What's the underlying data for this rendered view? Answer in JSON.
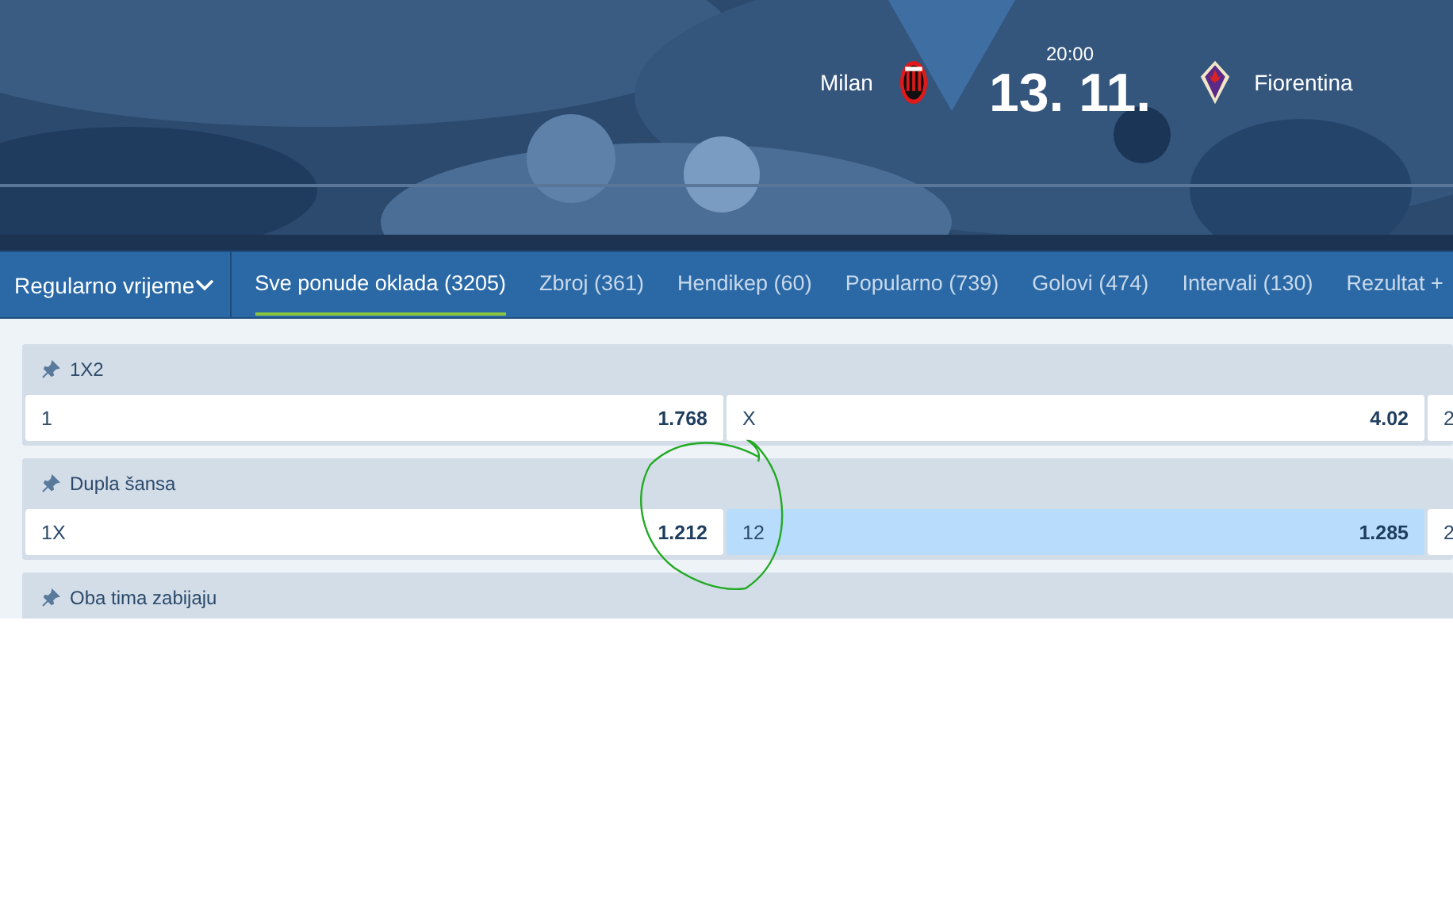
{
  "match": {
    "home": "Milan",
    "time": "20:00",
    "date": "13. 11.",
    "away": "Fiorentina"
  },
  "period_select": {
    "value": "Regularno vrijeme"
  },
  "tabs": [
    {
      "label": "Sve ponude oklada (3205)",
      "selected": true
    },
    {
      "label": "Zbroj (361)",
      "selected": false
    },
    {
      "label": "Hendikep (60)",
      "selected": false
    },
    {
      "label": "Popularno (739)",
      "selected": false
    },
    {
      "label": "Golovi (474)",
      "selected": false
    },
    {
      "label": "Intervali (130)",
      "selected": false
    },
    {
      "label": "Rezultat +",
      "selected": false
    }
  ],
  "markets": [
    {
      "title": "1X2",
      "odds": [
        {
          "label": "1",
          "value": "1.768",
          "selected": false
        },
        {
          "label": "X",
          "value": "4.02",
          "selected": false
        },
        {
          "label": "2",
          "selected": false
        }
      ]
    },
    {
      "title": "Dupla šansa",
      "odds": [
        {
          "label": "1X",
          "value": "1.212",
          "selected": false
        },
        {
          "label": "12",
          "value": "1.285",
          "selected": true
        },
        {
          "label": "2",
          "selected": false
        }
      ]
    },
    {
      "title": "Oba tima zabijaju"
    }
  ]
}
